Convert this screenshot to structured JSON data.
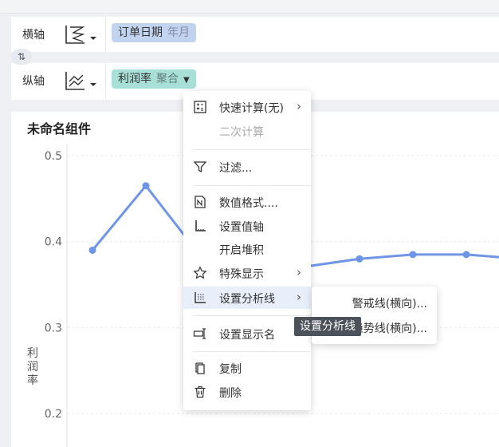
{
  "axis_panel": {
    "x_axis": {
      "label": "横轴",
      "field": "订单日期",
      "granularity": "年月",
      "icon": "axis-chart-icon"
    },
    "y_axis": {
      "label": "纵轴",
      "field": "利润率",
      "aggregation": "聚合",
      "icon": "line-chart-icon"
    },
    "swap_icon": "⇅"
  },
  "chart": {
    "title": "未命名组件",
    "ylabel": "利润率"
  },
  "chart_data": {
    "type": "line",
    "title": "未命名组件",
    "xlabel": "",
    "ylabel": "利润率",
    "ylim": [
      0.15,
      0.5
    ],
    "y_ticks": [
      "0.5",
      "0.4",
      "0.3",
      "0.2"
    ],
    "y_tick_values": [
      0.5,
      0.4,
      0.3,
      0.2
    ],
    "series": [
      {
        "values": [
          0.39,
          0.465,
          0.385,
          null,
          null,
          0.38,
          0.385,
          0.385,
          0.38
        ]
      }
    ],
    "grid": true,
    "color": "#6f95e6"
  },
  "context_menu": {
    "items": [
      {
        "label": "快速计算(无)",
        "icon": "quick-calc-icon",
        "submenu": true,
        "disabled": false
      },
      {
        "label": "二次计算",
        "icon": "",
        "submenu": false,
        "disabled": true
      },
      {
        "label": "过滤...",
        "icon": "filter-icon",
        "submenu": false,
        "disabled": false
      },
      {
        "label": "数值格式....",
        "icon": "number-format-icon",
        "submenu": false,
        "disabled": false
      },
      {
        "label": "设置值轴",
        "icon": "value-axis-icon",
        "submenu": false,
        "disabled": false
      },
      {
        "label": "开启堆积",
        "icon": "",
        "submenu": false,
        "disabled": false
      },
      {
        "label": "特殊显示",
        "icon": "star-icon",
        "submenu": true,
        "disabled": false
      },
      {
        "label": "设置分析线",
        "icon": "analysis-line-icon",
        "submenu": true,
        "disabled": false,
        "highlighted": true
      },
      {
        "label": "设置显示名",
        "icon": "rename-icon",
        "submenu": false,
        "disabled": false
      },
      {
        "label": "复制",
        "icon": "copy-icon",
        "submenu": false,
        "disabled": false
      },
      {
        "label": "删除",
        "icon": "trash-icon",
        "submenu": false,
        "disabled": false
      }
    ]
  },
  "submenu": {
    "items": [
      {
        "label": "警戒线(横向)..."
      },
      {
        "label": "趋势线(横向)..."
      }
    ]
  },
  "tooltip": {
    "text": "设置分析线"
  }
}
